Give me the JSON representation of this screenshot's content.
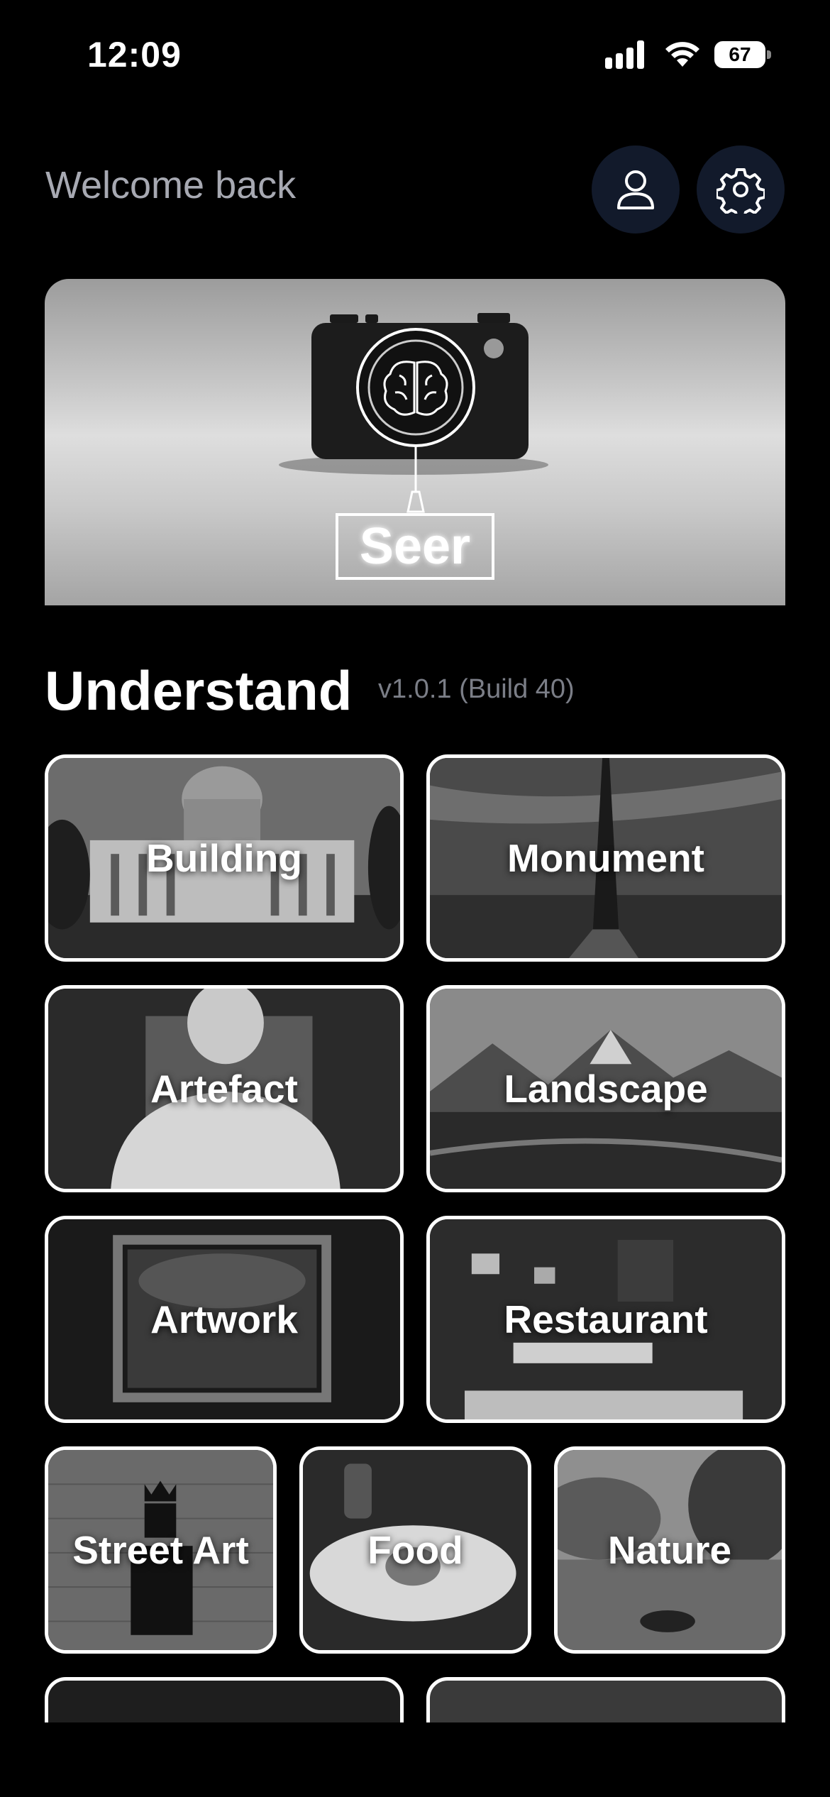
{
  "status_bar": {
    "time": "12:09",
    "battery": "67"
  },
  "header": {
    "welcome": "Welcome back"
  },
  "hero": {
    "logo_text": "Seer"
  },
  "section": {
    "title": "Understand",
    "version": "v1.0.1 (Build 40)"
  },
  "categories": [
    {
      "label": "Building"
    },
    {
      "label": "Monument"
    },
    {
      "label": "Artefact"
    },
    {
      "label": "Landscape"
    },
    {
      "label": "Artwork"
    },
    {
      "label": "Restaurant"
    },
    {
      "label": "Street Art"
    },
    {
      "label": "Food"
    },
    {
      "label": "Nature"
    }
  ],
  "colors": {
    "background": "#000000",
    "button_bg": "#121a2b",
    "muted_text": "#a7a9b2",
    "version_text": "#7b7e87",
    "tile_border": "#ffffff"
  }
}
